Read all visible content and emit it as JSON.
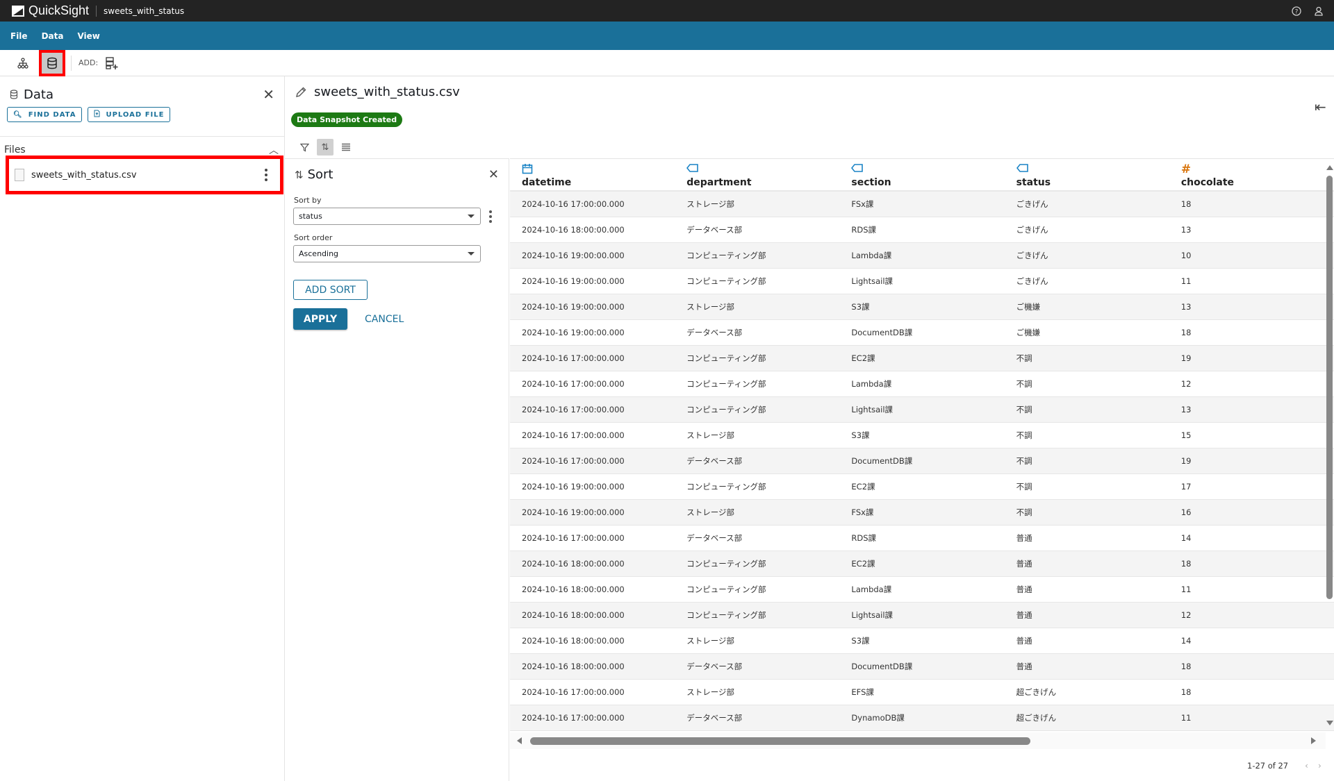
{
  "topbar": {
    "app_name": "QuickSight",
    "document_title": "sweets_with_status",
    "icons": [
      "help-icon",
      "user-icon"
    ]
  },
  "menubar": {
    "items": [
      "File",
      "Data",
      "View"
    ]
  },
  "toolbar": {
    "add_label": "ADD:",
    "buttons": [
      "hierarchy-icon",
      "database-icon",
      "add-data-icon"
    ]
  },
  "left_panel": {
    "title": "Data",
    "find_data_label": "FIND DATA",
    "upload_file_label": "UPLOAD FILE",
    "files_header": "Files",
    "files": [
      {
        "name": "sweets_with_status.csv"
      }
    ]
  },
  "main": {
    "dataset_name": "sweets_with_status.csv",
    "badge": "Data Snapshot Created",
    "badge_color": "#1d7a14"
  },
  "sort_panel": {
    "title": "Sort",
    "sort_by_label": "Sort by",
    "sort_by_value": "status",
    "sort_order_label": "Sort order",
    "sort_order_value": "Ascending",
    "add_sort_label": "ADD SORT",
    "apply_label": "APPLY",
    "cancel_label": "CANCEL"
  },
  "table": {
    "columns": [
      {
        "name": "datetime",
        "type_icon": "calendar-icon",
        "icon_color": "#1a84c6"
      },
      {
        "name": "department",
        "type_icon": "tag-icon",
        "icon_color": "#1a84c6"
      },
      {
        "name": "section",
        "type_icon": "tag-icon",
        "icon_color": "#1a84c6"
      },
      {
        "name": "status",
        "type_icon": "tag-icon",
        "icon_color": "#1a84c6"
      },
      {
        "name": "chocolate",
        "type_icon": "hash-icon",
        "icon_color": "#d9760e"
      }
    ],
    "rows": [
      [
        "2024-10-16 17:00:00.000",
        "ストレージ部",
        "FSx課",
        "ごきげん",
        "18"
      ],
      [
        "2024-10-16 18:00:00.000",
        "データベース部",
        "RDS課",
        "ごきげん",
        "13"
      ],
      [
        "2024-10-16 19:00:00.000",
        "コンピューティング部",
        "Lambda課",
        "ごきげん",
        "10"
      ],
      [
        "2024-10-16 19:00:00.000",
        "コンピューティング部",
        "Lightsail課",
        "ごきげん",
        "11"
      ],
      [
        "2024-10-16 19:00:00.000",
        "ストレージ部",
        "S3課",
        "ご機嫌",
        "13"
      ],
      [
        "2024-10-16 19:00:00.000",
        "データベース部",
        "DocumentDB課",
        "ご機嫌",
        "18"
      ],
      [
        "2024-10-16 17:00:00.000",
        "コンピューティング部",
        "EC2課",
        "不調",
        "19"
      ],
      [
        "2024-10-16 17:00:00.000",
        "コンピューティング部",
        "Lambda課",
        "不調",
        "12"
      ],
      [
        "2024-10-16 17:00:00.000",
        "コンピューティング部",
        "Lightsail課",
        "不調",
        "13"
      ],
      [
        "2024-10-16 17:00:00.000",
        "ストレージ部",
        "S3課",
        "不調",
        "15"
      ],
      [
        "2024-10-16 17:00:00.000",
        "データベース部",
        "DocumentDB課",
        "不調",
        "19"
      ],
      [
        "2024-10-16 19:00:00.000",
        "コンピューティング部",
        "EC2課",
        "不調",
        "17"
      ],
      [
        "2024-10-16 19:00:00.000",
        "ストレージ部",
        "FSx課",
        "不調",
        "16"
      ],
      [
        "2024-10-16 17:00:00.000",
        "データベース部",
        "RDS課",
        "普通",
        "14"
      ],
      [
        "2024-10-16 18:00:00.000",
        "コンピューティング部",
        "EC2課",
        "普通",
        "18"
      ],
      [
        "2024-10-16 18:00:00.000",
        "コンピューティング部",
        "Lambda課",
        "普通",
        "11"
      ],
      [
        "2024-10-16 18:00:00.000",
        "コンピューティング部",
        "Lightsail課",
        "普通",
        "12"
      ],
      [
        "2024-10-16 18:00:00.000",
        "ストレージ部",
        "S3課",
        "普通",
        "14"
      ],
      [
        "2024-10-16 18:00:00.000",
        "データベース部",
        "DocumentDB課",
        "普通",
        "18"
      ],
      [
        "2024-10-16 17:00:00.000",
        "ストレージ部",
        "EFS課",
        "超ごきげん",
        "18"
      ],
      [
        "2024-10-16 17:00:00.000",
        "データベース部",
        "DynamoDB課",
        "超ごきげん",
        "11"
      ]
    ],
    "pagination": "1-27 of 27"
  },
  "colors": {
    "topbar": "#232323",
    "menubar": "#1a7099",
    "accent": "#1a7099",
    "highlight": "#ff0000"
  }
}
